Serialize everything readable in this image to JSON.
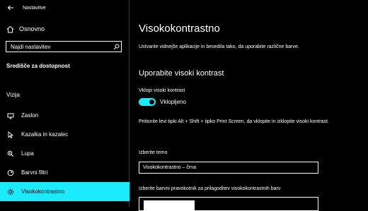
{
  "titlebar": {
    "title": "Nastavitve"
  },
  "sidebar": {
    "home_label": "Osnovno",
    "search_placeholder": "Najdi nastavitev",
    "center_title": "Središče za dostopnost",
    "group_title": "Vizija",
    "items": [
      {
        "label": "Zaslon",
        "icon": "monitor-icon"
      },
      {
        "label": "Kazalka in kazalec",
        "icon": "cursor-icon"
      },
      {
        "label": "Lupa",
        "icon": "magnifier-icon"
      },
      {
        "label": "Barvni filtri",
        "icon": "color-filter-icon"
      },
      {
        "label": "Visokokontrastno",
        "icon": "contrast-icon",
        "selected": true
      }
    ],
    "accent_color": "#1aebff"
  },
  "main": {
    "title": "Visokokontrastno",
    "description": "Ustvarite vidnejše aplikacije in besedila tako, da uporabite različne barve.",
    "section_title": "Uporabite visoki kontrast",
    "toggle_label": "Vklopi visoki kontrast",
    "toggle_state": "Vklopljeno",
    "hint": "Pritisnite levi tipki Alt + Shift + tipko Print Screen, da vklopite in izklopite visoki kontrast.",
    "theme_label": "Izberite temo",
    "theme_value": "Visokokontrastno – črna",
    "color_label": "Izberite barvni pravokotnik za prilagoditev visokokontrastnih barv"
  }
}
